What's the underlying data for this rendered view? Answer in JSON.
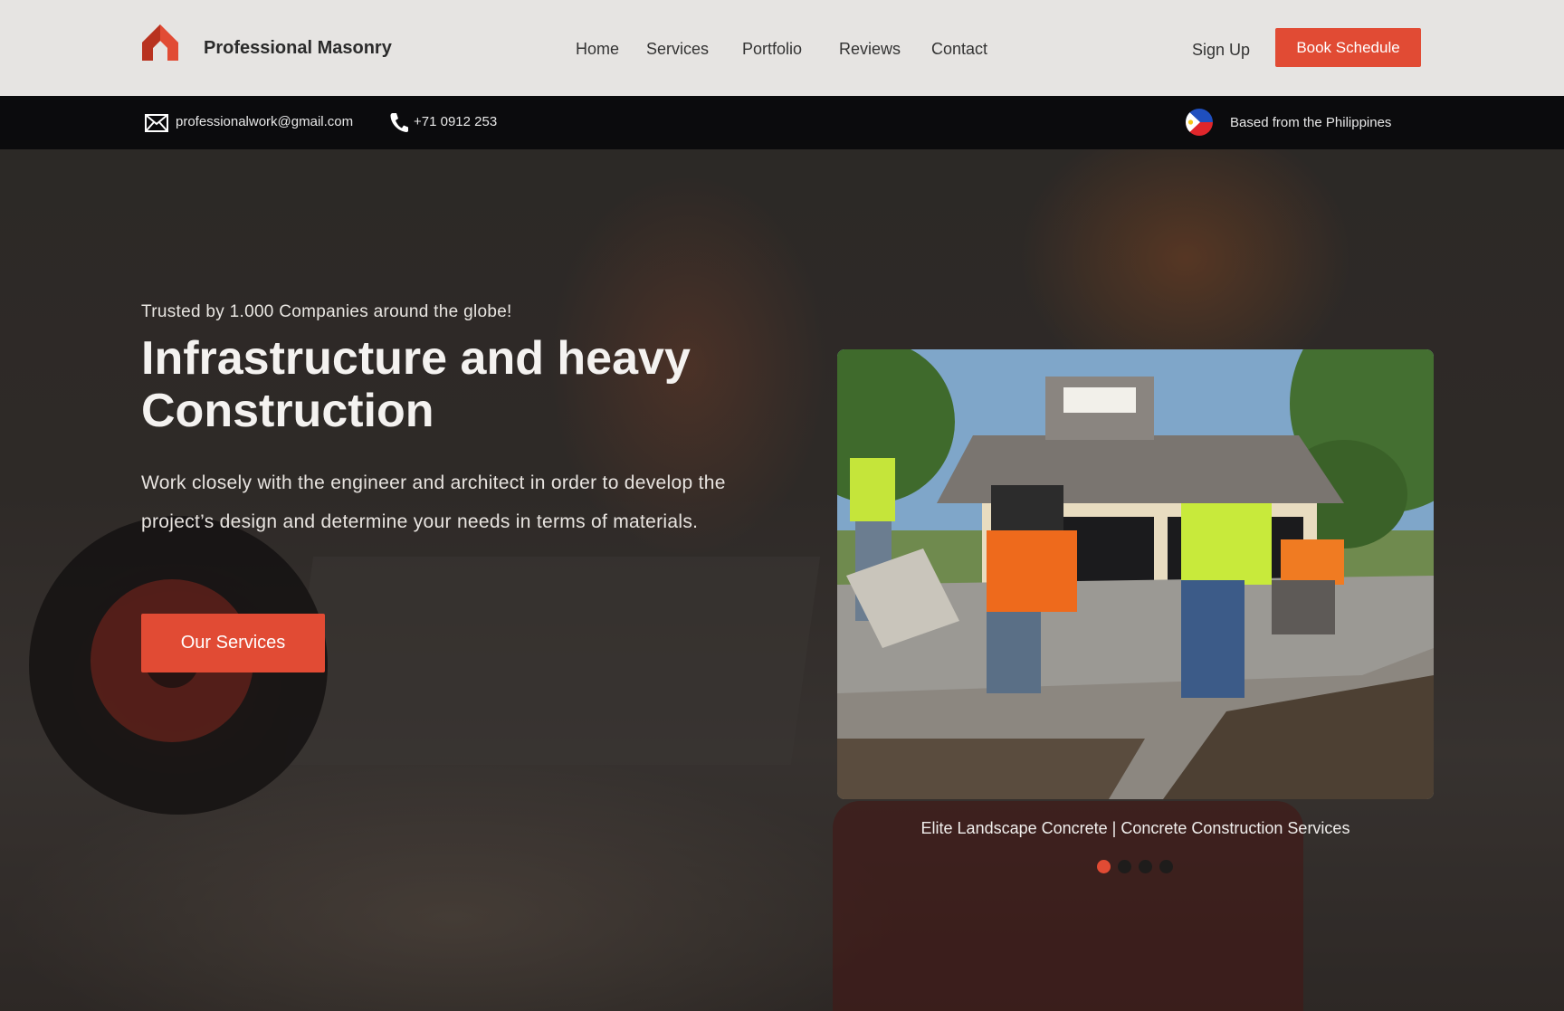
{
  "brand": {
    "name": "Professional Masonry",
    "accent": "#e14b34"
  },
  "nav": {
    "links": [
      "Home",
      "Services",
      "Portfolio",
      "Reviews",
      "Contact"
    ],
    "sign_up": "Sign Up",
    "book": "Book Schedule"
  },
  "infobar": {
    "email": "professionalwork@gmail.com",
    "phone": "+71 0912 253",
    "location": "Based from the Philippines",
    "icons": [
      "envelope-icon",
      "phone-icon",
      "philippines-flag-icon"
    ]
  },
  "hero": {
    "tagline": "Trusted by 1.000 Companies around the globe!",
    "headline": "Infrastructure and heavy Construction",
    "description": "Work closely with the engineer and architect in order to develop the project’s design and determine your needs in terms of materials.",
    "cta": "Our Services"
  },
  "slider": {
    "caption": "Elite Landscape Concrete | Concrete Construction Services",
    "slide_count": 4,
    "active_index": 0
  }
}
